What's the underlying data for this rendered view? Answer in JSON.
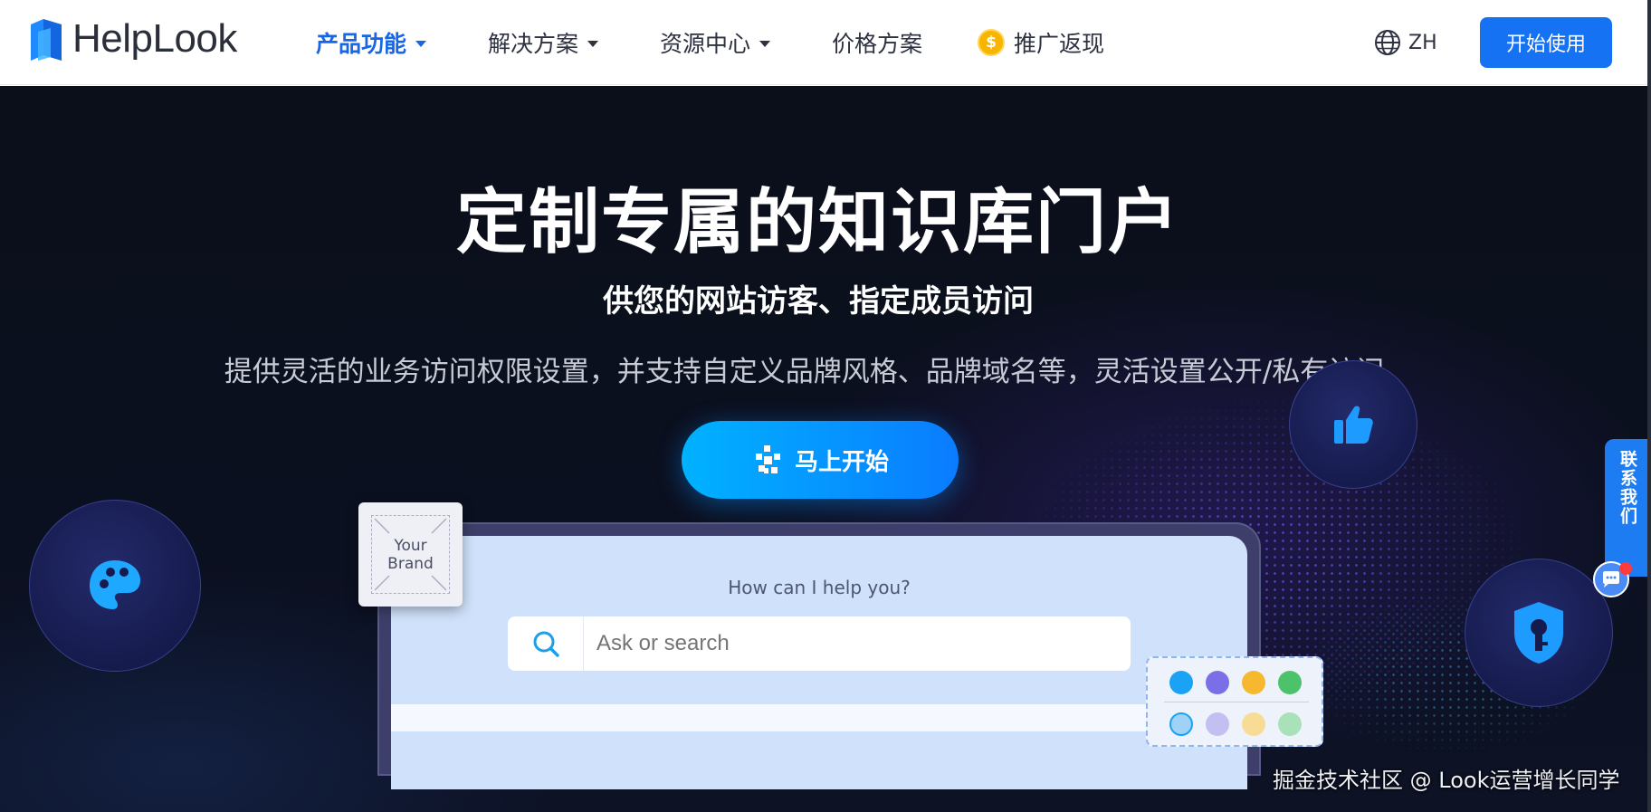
{
  "brand": {
    "logo_text": "HelpLook"
  },
  "nav": {
    "items": [
      {
        "label": "产品功能",
        "has_dropdown": true,
        "active": true
      },
      {
        "label": "解决方案",
        "has_dropdown": true,
        "active": false
      },
      {
        "label": "资源中心",
        "has_dropdown": true,
        "active": false
      },
      {
        "label": "价格方案",
        "has_dropdown": false,
        "active": false
      },
      {
        "label": "推广返现",
        "has_dropdown": false,
        "active": false,
        "icon": "coin-icon"
      }
    ],
    "promo_coin_symbol": "$",
    "language": "ZH",
    "cta_label": "开始使用"
  },
  "hero": {
    "title": "定制专属的知识库门户",
    "subtitle": "供您的网站访客、指定成员访问",
    "description": "提供灵活的业务访问权限设置，并支持自定义品牌风格、品牌域名等，灵活设置公开/私有访问。",
    "cta_label": "马上开始"
  },
  "side_contact": {
    "label": "联系我们"
  },
  "mockup": {
    "brand_card_line1": "Your",
    "brand_card_line2": "Brand",
    "question": "How can I help you?",
    "search_placeholder": "Ask or search",
    "swatch_colors": [
      "#1aa3f5",
      "#7b6fe8",
      "#f5b82e",
      "#4cc26b"
    ]
  },
  "watermark": "掘金技术社区 @ Look运营增长同学",
  "colors": {
    "accent": "#1572f3",
    "nav_active": "#1766e5",
    "hero_bg": "#0b0f1a",
    "cta_gradient_start": "#00b2ff",
    "cta_gradient_end": "#0a7cff"
  }
}
